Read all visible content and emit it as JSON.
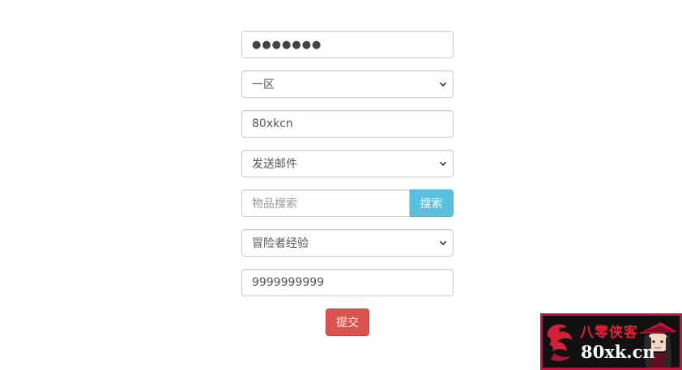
{
  "form": {
    "password_value": "●●●●●●●",
    "server_select": "一区",
    "username_value": "80xkcn",
    "action_select": "发送邮件",
    "item_search_placeholder": "物品搜索",
    "search_button": "搜索",
    "item_select": "冒险者经验",
    "quantity_value": "9999999999",
    "submit_button": "提交"
  },
  "watermark": {
    "title_cn": "八零侠客",
    "site": "80xk.cn"
  },
  "colors": {
    "search_button": "#5bc0de",
    "submit_button": "#d9534f",
    "logo_border": "#c4143c",
    "logo_background": "#111111"
  },
  "icons": {
    "select_arrow": "chevron-down-icon",
    "logo_mark": "dragon-icon",
    "logo_character": "character-portrait"
  }
}
